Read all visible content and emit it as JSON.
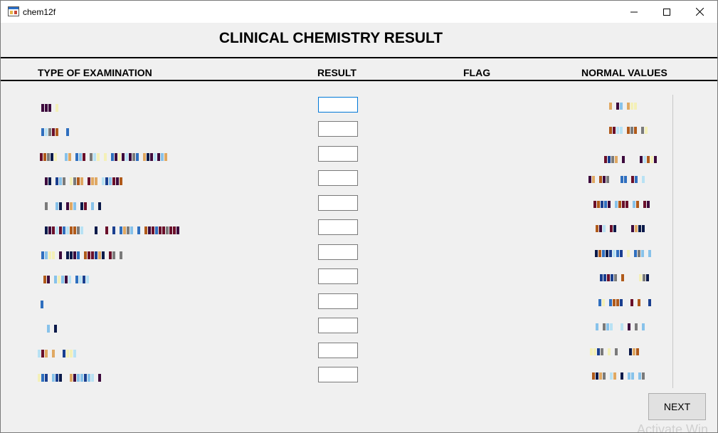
{
  "window": {
    "title": "chem12f"
  },
  "controls": {
    "minimize": "minimize",
    "maximize": "maximize",
    "close": "close"
  },
  "header": {
    "title": "CLINICAL CHEMISTRY RESULT"
  },
  "columns": {
    "type": "TYPE OF EXAMINATION",
    "result": "RESULT",
    "flag": "FLAG",
    "normal": "NORMAL VALUES"
  },
  "rows": [
    {
      "label": "",
      "result": "",
      "flag": "",
      "normal": ""
    },
    {
      "label": "",
      "result": "",
      "flag": "",
      "normal": ""
    },
    {
      "label": "",
      "result": "",
      "flag": "",
      "normal": ""
    },
    {
      "label": "",
      "result": "",
      "flag": "",
      "normal": ""
    },
    {
      "label": "",
      "result": "",
      "flag": "",
      "normal": ""
    },
    {
      "label": "",
      "result": "",
      "flag": "",
      "normal": ""
    },
    {
      "label": "",
      "result": "",
      "flag": "",
      "normal": ""
    },
    {
      "label": "",
      "result": "",
      "flag": "",
      "normal": ""
    },
    {
      "label": "",
      "result": "",
      "flag": "",
      "normal": ""
    },
    {
      "label": "",
      "result": "",
      "flag": "",
      "normal": ""
    },
    {
      "label": "",
      "result": "",
      "flag": "",
      "normal": ""
    },
    {
      "label": "",
      "result": "",
      "flag": "",
      "normal": ""
    }
  ],
  "next_button": {
    "label": "NEXT"
  },
  "watermark": "Activate Win",
  "icons": {
    "app": "app-window-icon",
    "minimize": "minimize-icon",
    "maximize": "maximize-icon",
    "close": "close-icon"
  },
  "colors": {
    "titlebar": "#ffffff",
    "background": "#f0f0f0",
    "focus_border": "#0078d7",
    "input_border": "#7a7a7a"
  }
}
